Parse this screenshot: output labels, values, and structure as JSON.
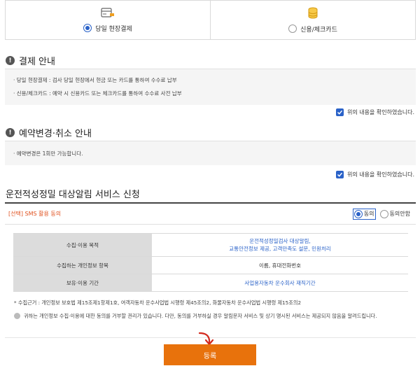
{
  "payment": {
    "options": [
      {
        "label": "당일 현장결제",
        "selected": true,
        "icon": "card-reader-icon"
      },
      {
        "label": "신용/체크카드",
        "selected": false,
        "icon": "coin-stack-icon"
      }
    ]
  },
  "payment_info": {
    "title": "결제 안내",
    "lines": [
      "· 당일 현장결제 : 검사 당일 현장에서 현금 또는 카드를 통하여 수수료 납부",
      "· 신용/체크카드 : 예약 시 신용카드 또는 체크카드를 통하여 수수료 사전 납부"
    ],
    "confirm_label": "위의 내용을 확인하였습니다.",
    "confirmed": true
  },
  "change_info": {
    "title": "예약변경·취소 안내",
    "lines": [
      "· 예약변경은 1회만 가능합니다."
    ],
    "confirm_label": "위의 내용을 확인하였습니다.",
    "confirmed": true
  },
  "sms": {
    "title": "운전적성정밀 대상알림 서비스 신청",
    "consent_label": "[선택] SMS 활용 동의",
    "agree_label": "동의",
    "disagree_label": "동의안함",
    "agree_selected": true,
    "table": [
      {
        "header": "수집·이용 목적",
        "value_lines": [
          "운전적성정밀검사 대상알림,",
          "교통안전정보 제공, 고객만족도 설문, 민원처리"
        ],
        "link": true
      },
      {
        "header": "수집하는 개인정보 항목",
        "value_lines": [
          "이름, 휴대전화번호"
        ],
        "link": false
      },
      {
        "header": "보유·이용 기간",
        "value_lines": [
          "사업용자동차 운수회사 재직기간"
        ],
        "link": true
      }
    ],
    "footnote": "* 수집근거 : 개인정보 보호법 제15조제1항제1호, 여객자동차 운수사업법 시행령 제45조의2, 화물자동차 운수사업법 시행령 제15조의2",
    "notice": "귀하는 개인정보 수집·이용에 대한 동의를 거부할 권리가 있습니다. 다만, 동의를 거부하실 경우 알림문자 서비스 및 상기 명시된 서비스는 제공되지 않음을 알려드립니다."
  },
  "submit_label": "등록",
  "colors": {
    "accent": "#2a62c8",
    "orange": "#e8720c",
    "consent_label": "#e0501e"
  }
}
